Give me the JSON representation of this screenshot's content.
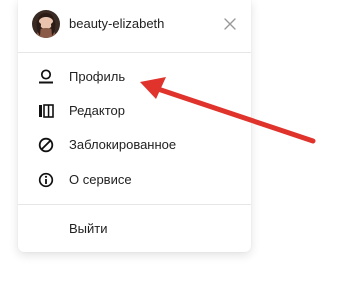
{
  "user": {
    "name": "beauty-elizabeth",
    "avatar_icon": "avatar-photo"
  },
  "header": {
    "close_icon": "close-icon"
  },
  "menu": {
    "items": [
      {
        "label": "Профиль",
        "icon": "profile-icon"
      },
      {
        "label": "Редактор",
        "icon": "editor-icon"
      },
      {
        "label": "Заблокированное",
        "icon": "blocked-icon"
      },
      {
        "label": "О сервисе",
        "icon": "info-icon"
      }
    ],
    "logout_label": "Выйти"
  },
  "annotation": {
    "arrow_color": "#e0332c"
  }
}
